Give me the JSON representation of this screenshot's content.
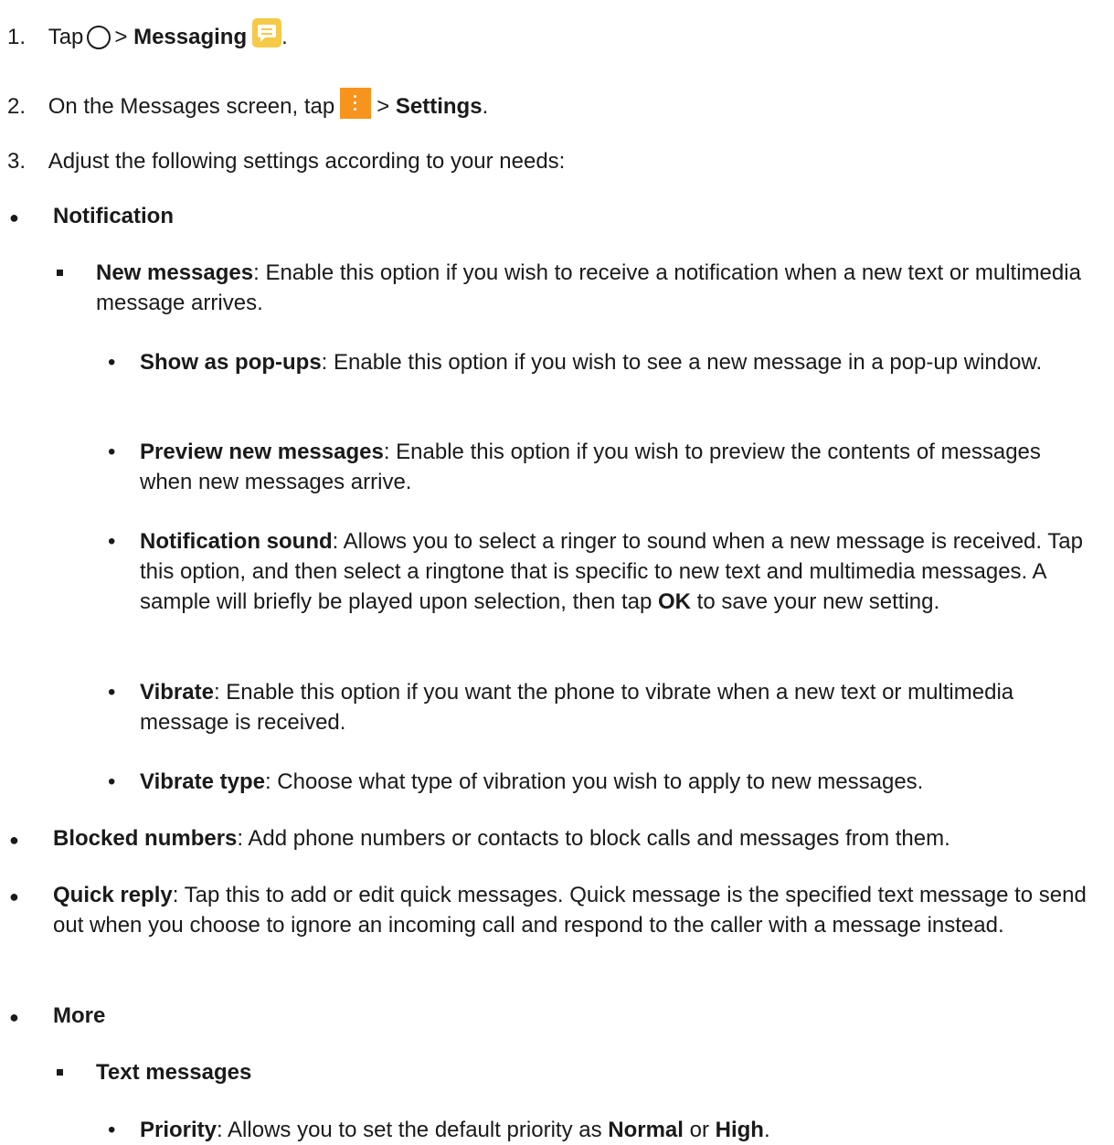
{
  "steps": [
    {
      "num": "1.",
      "pre": "Tap",
      "gt": ">",
      "bold": "Messaging",
      "post": "."
    },
    {
      "num": "2.",
      "pre": "On the Messages screen, tap",
      "gt": "> ",
      "bold": "Settings",
      "post": "."
    },
    {
      "num": "3.",
      "text": "Adjust the following settings according to your needs:"
    }
  ],
  "notification": {
    "title": "Notification",
    "new_messages": {
      "term": "New messages",
      "desc": ": Enable this option if you wish to receive a notification when a new text or multimedia message arrives."
    },
    "show_popups": {
      "term": "Show as pop-ups",
      "desc": ": Enable this option if you wish to see a new message in a pop-up window."
    },
    "preview": {
      "term": "Preview new messages",
      "desc": ": Enable this option if you wish to preview the contents of messages when new messages arrive."
    },
    "sound": {
      "term": "Notification sound",
      "desc1": ": Allows you to select a ringer to sound when a new message is received. Tap this option, and then select a ringtone that is specific to new text and multimedia messages. A sample will briefly be played upon selection, then tap ",
      "ok": "OK",
      "desc2": " to save your new setting."
    },
    "vibrate": {
      "term": "Vibrate",
      "desc": ": Enable this option if you want the phone to vibrate when a new text or multimedia message is received."
    },
    "vibrate_type": {
      "term": "Vibrate type",
      "desc": ": Choose what type of vibration you wish to apply to new messages."
    }
  },
  "blocked": {
    "term": "Blocked numbers",
    "desc": ": Add phone numbers or contacts to block calls and messages from them."
  },
  "quick_reply": {
    "term": "Quick reply",
    "desc": ": Tap this to add or edit quick messages. Quick message is the specified text message to send out when you choose to ignore an incoming call and respond to the caller with a message instead."
  },
  "more": {
    "title": "More",
    "text_messages": "Text messages",
    "priority": {
      "term": "Priority",
      "desc1": ": Allows you to set the default priority as ",
      "normal": "Normal",
      "or": " or ",
      "high": "High",
      "end": "."
    }
  },
  "icons": {
    "home": "home-circle-icon",
    "messaging": "messaging-app-icon",
    "menu": "more-options-icon"
  },
  "colors": {
    "messaging_icon": "#f7c948",
    "menu_icon": "#f7941d"
  }
}
